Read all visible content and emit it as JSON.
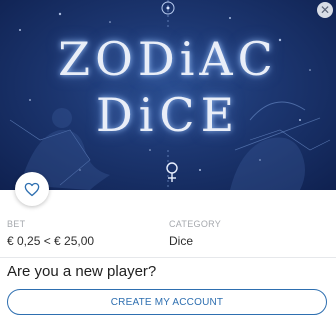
{
  "game": {
    "title_line1": "ZODiAC",
    "title_line2": "DiCE"
  },
  "info": {
    "bet_label": "BET",
    "bet_value": "€ 0,25 < € 25,00",
    "category_label": "CATEGORY",
    "category_value": "Dice"
  },
  "signup": {
    "question": "Are you a new player?",
    "button_label": "CREATE MY ACCOUNT"
  },
  "icons": {
    "close": "close-icon",
    "favorite": "heart-icon",
    "zodiac_symbol": "venus-symbol-icon"
  },
  "colors": {
    "hero_bg": "#1c3670",
    "accent": "#2e6fb0"
  }
}
